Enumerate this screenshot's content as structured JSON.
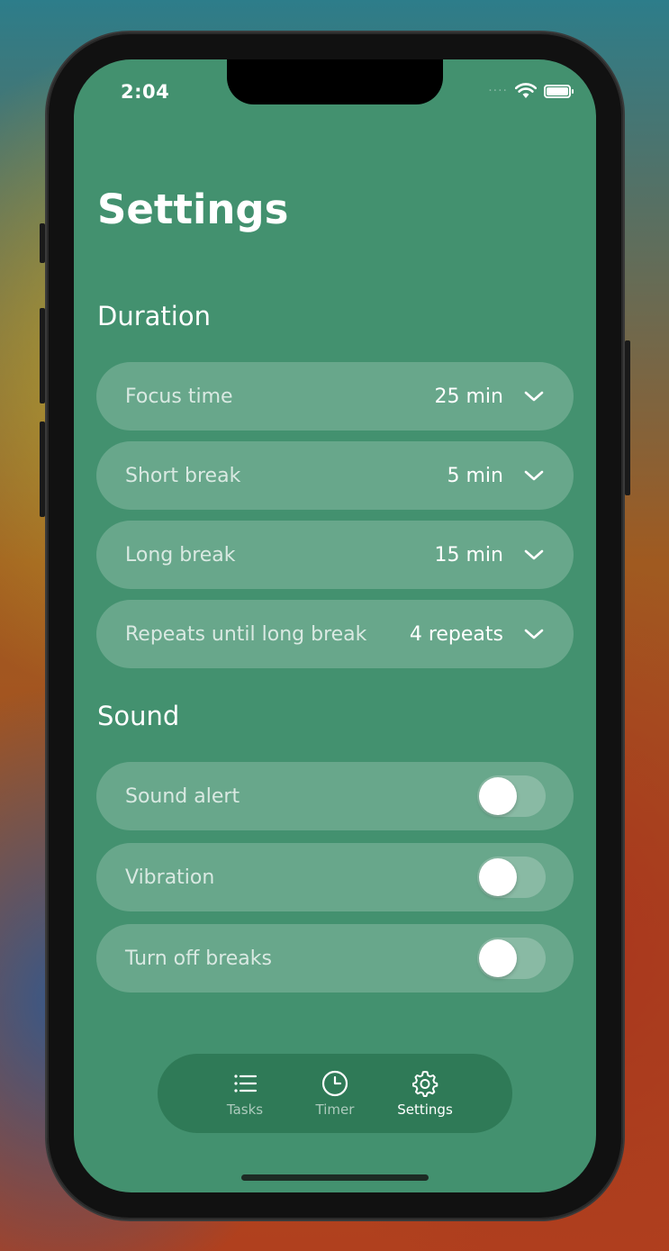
{
  "status_bar": {
    "time": "2:04",
    "signal": "····"
  },
  "page": {
    "title": "Settings"
  },
  "duration": {
    "heading": "Duration",
    "rows": [
      {
        "label": "Focus time",
        "value": "25 min"
      },
      {
        "label": "Short break",
        "value": "5 min"
      },
      {
        "label": "Long break",
        "value": "15 min"
      },
      {
        "label": "Repeats until long break",
        "value": "4 repeats"
      }
    ]
  },
  "sound": {
    "heading": "Sound",
    "rows": [
      {
        "label": "Sound alert",
        "enabled": false
      },
      {
        "label": "Vibration",
        "enabled": false
      },
      {
        "label": "Turn off breaks",
        "enabled": false
      }
    ]
  },
  "tabbar": {
    "tabs": [
      {
        "label": "Tasks",
        "icon": "list-icon",
        "active": false
      },
      {
        "label": "Timer",
        "icon": "clock-icon",
        "active": false
      },
      {
        "label": "Settings",
        "icon": "gear-icon",
        "active": true
      }
    ]
  },
  "colors": {
    "background": "#43916f",
    "row": "#68a887",
    "tabbar": "#2f7a57"
  }
}
